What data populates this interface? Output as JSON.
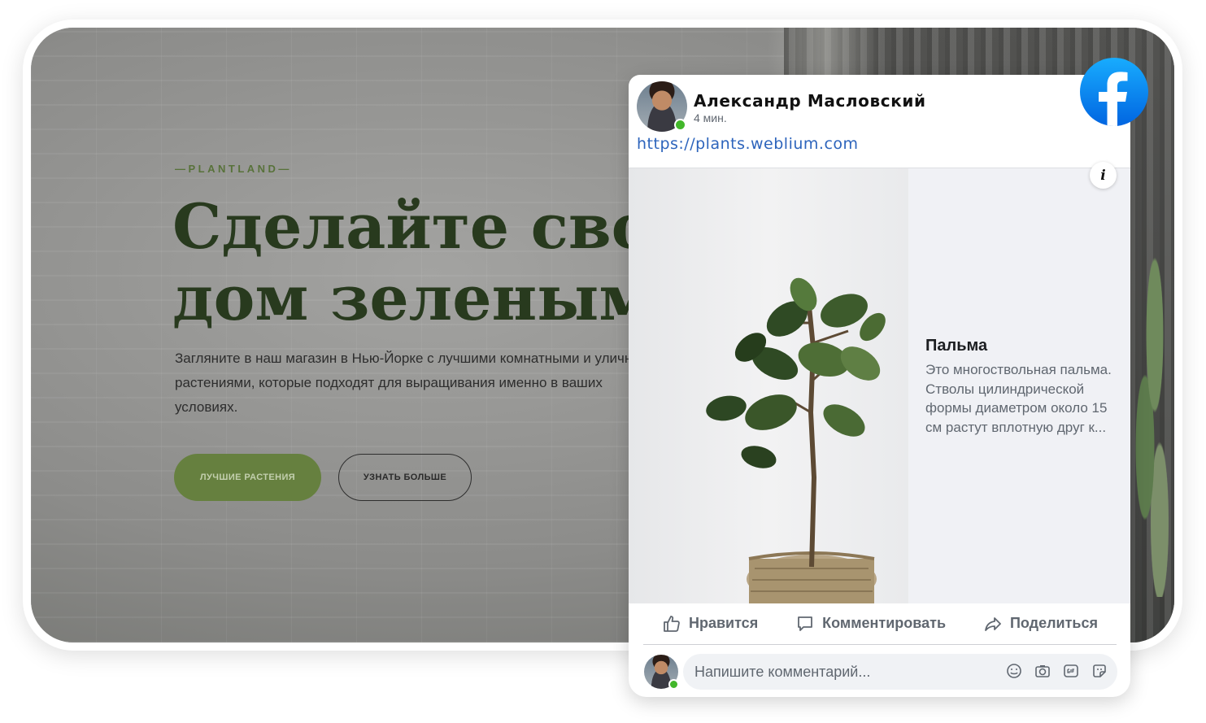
{
  "site": {
    "eyebrow": "—PLANTLAND—",
    "headline_line1": "Сделайте свой",
    "headline_line2": "дом зеленым",
    "lead": "Загляните в наш магазин в Нью-Йорке с лучшими комнатными и уличными растениями, которые подходят для выращивания именно в ваших условиях.",
    "primary_button": "ЛУЧШИЕ РАСТЕНИЯ",
    "secondary_button": "УЗНАТЬ БОЛЬШЕ",
    "colors": {
      "accent": "#66803f",
      "headline": "#283a1e"
    }
  },
  "post": {
    "author": "Александр Масловский",
    "time": "4 мин.",
    "link": "https://plants.weblium.com",
    "product_title": "Пальма",
    "product_description": "Это многоствольная пальма. Стволы цилиндрической формы диаметром около 15 см растут вплотную друг к...",
    "info_icon": "i",
    "actions": {
      "like": "Нравится",
      "comment": "Комментировать",
      "share": "Поделиться"
    },
    "comment_placeholder": "Напишите комментарий...",
    "comment_icons": [
      "emoji-icon",
      "camera-icon",
      "gif-icon",
      "sticker-icon"
    ],
    "brand_color": "#1877f2"
  }
}
